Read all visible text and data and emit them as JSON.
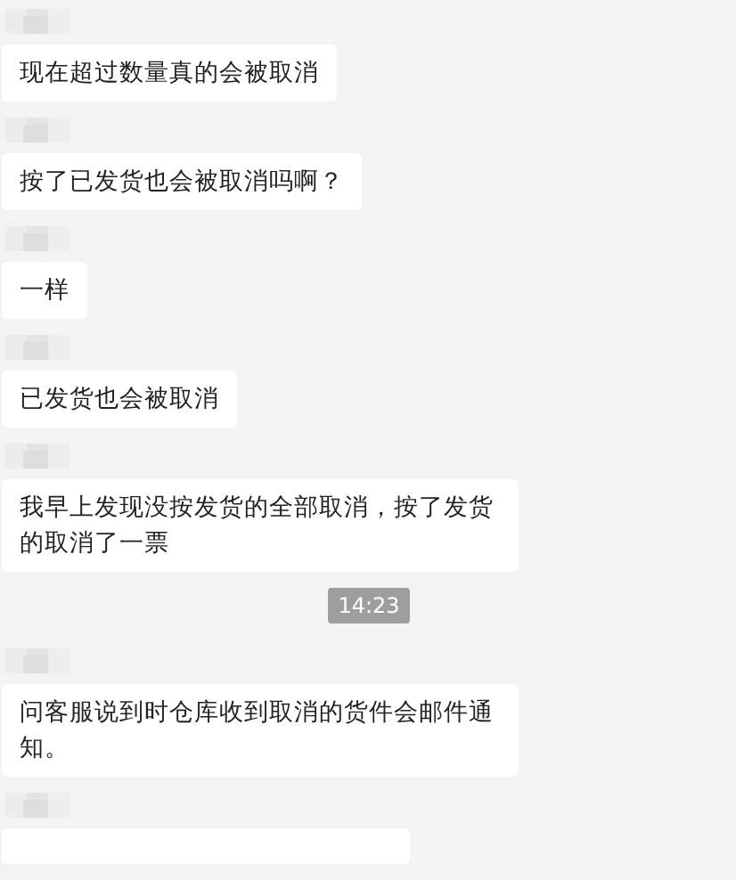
{
  "messages": [
    {
      "kind": "message",
      "text": "现在超过数量真的会被取消"
    },
    {
      "kind": "message",
      "text": "按了已发货也会被取消吗啊？"
    },
    {
      "kind": "message",
      "text": "一样"
    },
    {
      "kind": "message",
      "text": "已发货也会被取消"
    },
    {
      "kind": "message",
      "text": "我早上发现没按发货的全部取消，按了发货的取消了一票"
    },
    {
      "kind": "time",
      "text": "14:23"
    },
    {
      "kind": "message",
      "text": "问客服说到时仓库收到取消的货件会邮件通知。"
    },
    {
      "kind": "partial"
    }
  ]
}
